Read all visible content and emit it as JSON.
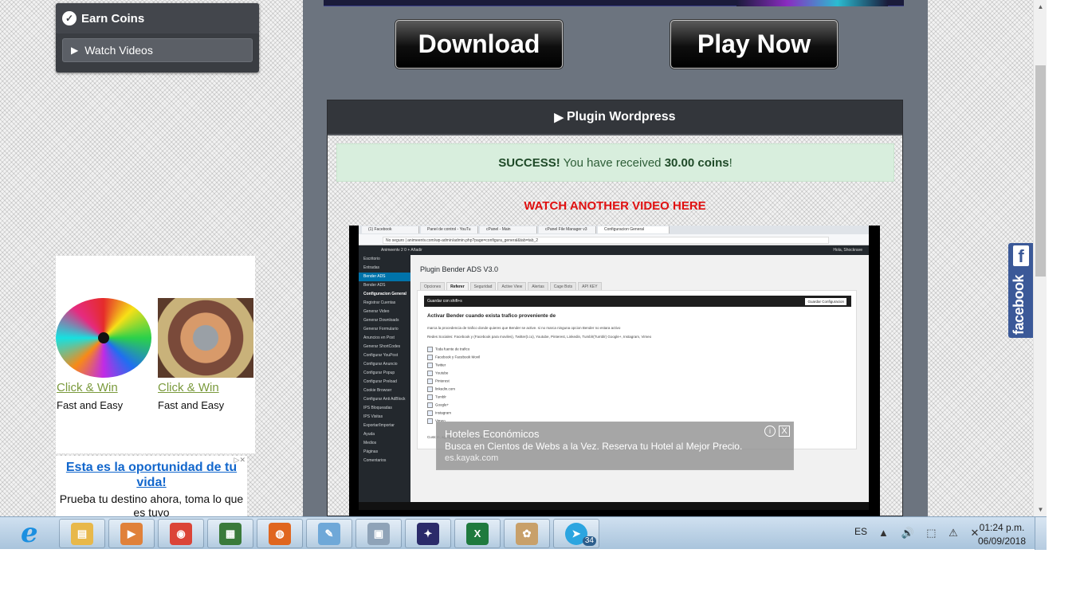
{
  "sidebar": {
    "earn_title": "Earn Coins",
    "watch_videos": "Watch Videos"
  },
  "ad": {
    "items": [
      {
        "link": "Click & Win",
        "sub": "Fast and Easy"
      },
      {
        "link": "Click & Win",
        "sub": "Fast and Easy"
      }
    ]
  },
  "ad2": {
    "title": "Esta es la oportunidad de tu vida!",
    "desc": "Prueba tu destino ahora, toma lo que es tuyo"
  },
  "buttons": {
    "download": "Download",
    "play_now": "Play Now"
  },
  "panel": {
    "title": "Plugin Wordpress",
    "success_strong": "SUCCESS!",
    "success_text": " You have received ",
    "success_amount": "30.00 coins",
    "success_end": "!",
    "watch_another": "WATCH ANOTHER VIDEO HERE"
  },
  "video": {
    "tabs": [
      "(1) Facebook",
      "Panel de control - YouTu",
      "cPanel - Main",
      "cPanel File Manager v3",
      "Configuracion General"
    ],
    "address": "No seguro  |  animeentv.com/wp-admin/admin.php?page=configura_general&tab=tab_2",
    "wpbar_left": "Animeentv   2   0   + Añadir",
    "wpbar_right": "Hola, Shockrave",
    "side_items": [
      "Escritorio",
      "Entradas",
      "Bender ADS",
      "Bender ADS",
      "Configuracion General",
      "Registrar Cuentas",
      "Generar Video",
      "Generar Downloads",
      "Generar Formulario",
      "Anuncios en Post",
      "Generar ShortCodes",
      "Configurar YouPost",
      "Configurar Anuncio",
      "Configurar Popup",
      "Configurar Preload",
      "Cookie Browser",
      "Configurar Anti AdBlock",
      "IPS Bloqueadas",
      "IPS Visitas",
      "Exportar/Importar",
      "Ayuda",
      "Medios",
      "Páginas",
      "Comentarios"
    ],
    "h1": "Plugin Bender ADS V3.0",
    "subtabs": [
      "Opciones",
      "Referer",
      "Seguridad",
      "Active View",
      "Alertas",
      "Cage Bots",
      "API KEY"
    ],
    "card_head": "Guardar con shift+s",
    "save_label": "Guardar Configuracion",
    "card_title": "Activar Bender cuando exista trafico proveniente de",
    "line1": "marca la procedencia de trafico donde quieres que Bender se active. si no marca ninguna opcion Bender no estara activo",
    "line2": "Redes Sociales: Facebook y (Facebook para moviles), Twitter(t.co), Youtube, Pinterest, Linkedin, Tumblr(Tumblr) Google+, Instagram, Vimeo",
    "checks": [
      "Toda fuente de trafico",
      "Facebook y Facebook Movil",
      "Twitter",
      "Youtube",
      "Pinterest",
      "linkedin.com",
      "Tumblr",
      "Google+",
      "Instagram",
      "Vimeo"
    ],
    "custom_line": "Custom, agrega otras fuentes de trafico",
    "ad_title": "Hoteles Económicos",
    "ad_desc": "Busca en Cientos de Webs a la Vez. Reserva tu Hotel al Mejor Precio.",
    "ad_url": "es.kayak.com",
    "ad_info": "i",
    "ad_close": "X"
  },
  "facebook": {
    "f": "f",
    "word": "facebook"
  },
  "taskbar": {
    "apps": [
      {
        "name": "explorer",
        "color": "#e8b84a",
        "glyph": "▤"
      },
      {
        "name": "media",
        "color": "#e0813a",
        "glyph": "▶"
      },
      {
        "name": "chrome",
        "color": "#db4437",
        "glyph": "◉"
      },
      {
        "name": "monitor",
        "color": "#3a7a3a",
        "glyph": "▦"
      },
      {
        "name": "firefox",
        "color": "#e0661f",
        "glyph": "◍"
      },
      {
        "name": "notepad",
        "color": "#6fa8d8",
        "glyph": "✎"
      },
      {
        "name": "calculator",
        "color": "#8fa3b8",
        "glyph": "▣"
      },
      {
        "name": "game",
        "color": "#2b2b6a",
        "glyph": "✦"
      },
      {
        "name": "excel",
        "color": "#1f7a3e",
        "glyph": "X"
      },
      {
        "name": "paint",
        "color": "#c8a06a",
        "glyph": "✿"
      },
      {
        "name": "telegram",
        "color": "#2ca5e0",
        "glyph": "➤"
      }
    ],
    "telegram_badge": "34",
    "lang": "ES",
    "tray_icons": "▲ 🔊 ⬚ ⚠ ✕",
    "time": "01:24 p.m.",
    "date": "06/09/2018"
  },
  "colors": {
    "success_bg": "#d8eedd",
    "watch_another": "#e01010",
    "facebook": "#3b5998"
  }
}
